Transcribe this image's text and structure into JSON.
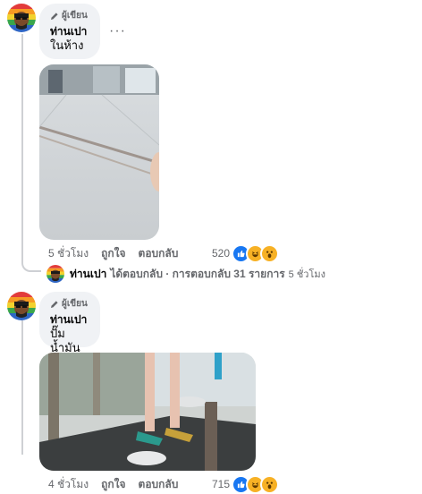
{
  "comments": [
    {
      "author_badge": "ผู้เขียน",
      "name": "ท่านเปา",
      "text": "ในห้าง",
      "more_icon": "more-dots-icon",
      "actions": {
        "time": "5 ชั่วโมง",
        "like": "ถูกใจ",
        "reply": "ตอบกลับ"
      },
      "reaction_count": "520",
      "reactions": [
        "like-icon",
        "haha-icon",
        "wow-icon"
      ]
    },
    {
      "author_badge": "ผู้เขียน",
      "name": "ท่านเปา",
      "text": "ปั๊มน้ำมัน",
      "actions": {
        "time": "4 ชั่วโมง",
        "like": "ถูกใจ",
        "reply": "ตอบกลับ"
      },
      "reaction_count": "715",
      "reactions": [
        "like-icon",
        "haha-icon",
        "wow-icon"
      ]
    }
  ],
  "reply_summary": {
    "name": "ท่านเปา",
    "text": "ได้ตอบกลับ · การตอบกลับ 31 รายการ",
    "time": "5 ชั่วโมง"
  },
  "colors": {
    "bubble": "#f0f2f5",
    "meta": "#65676b",
    "like_blue": "#1877f2",
    "haha_yellow": "#f7b125"
  }
}
